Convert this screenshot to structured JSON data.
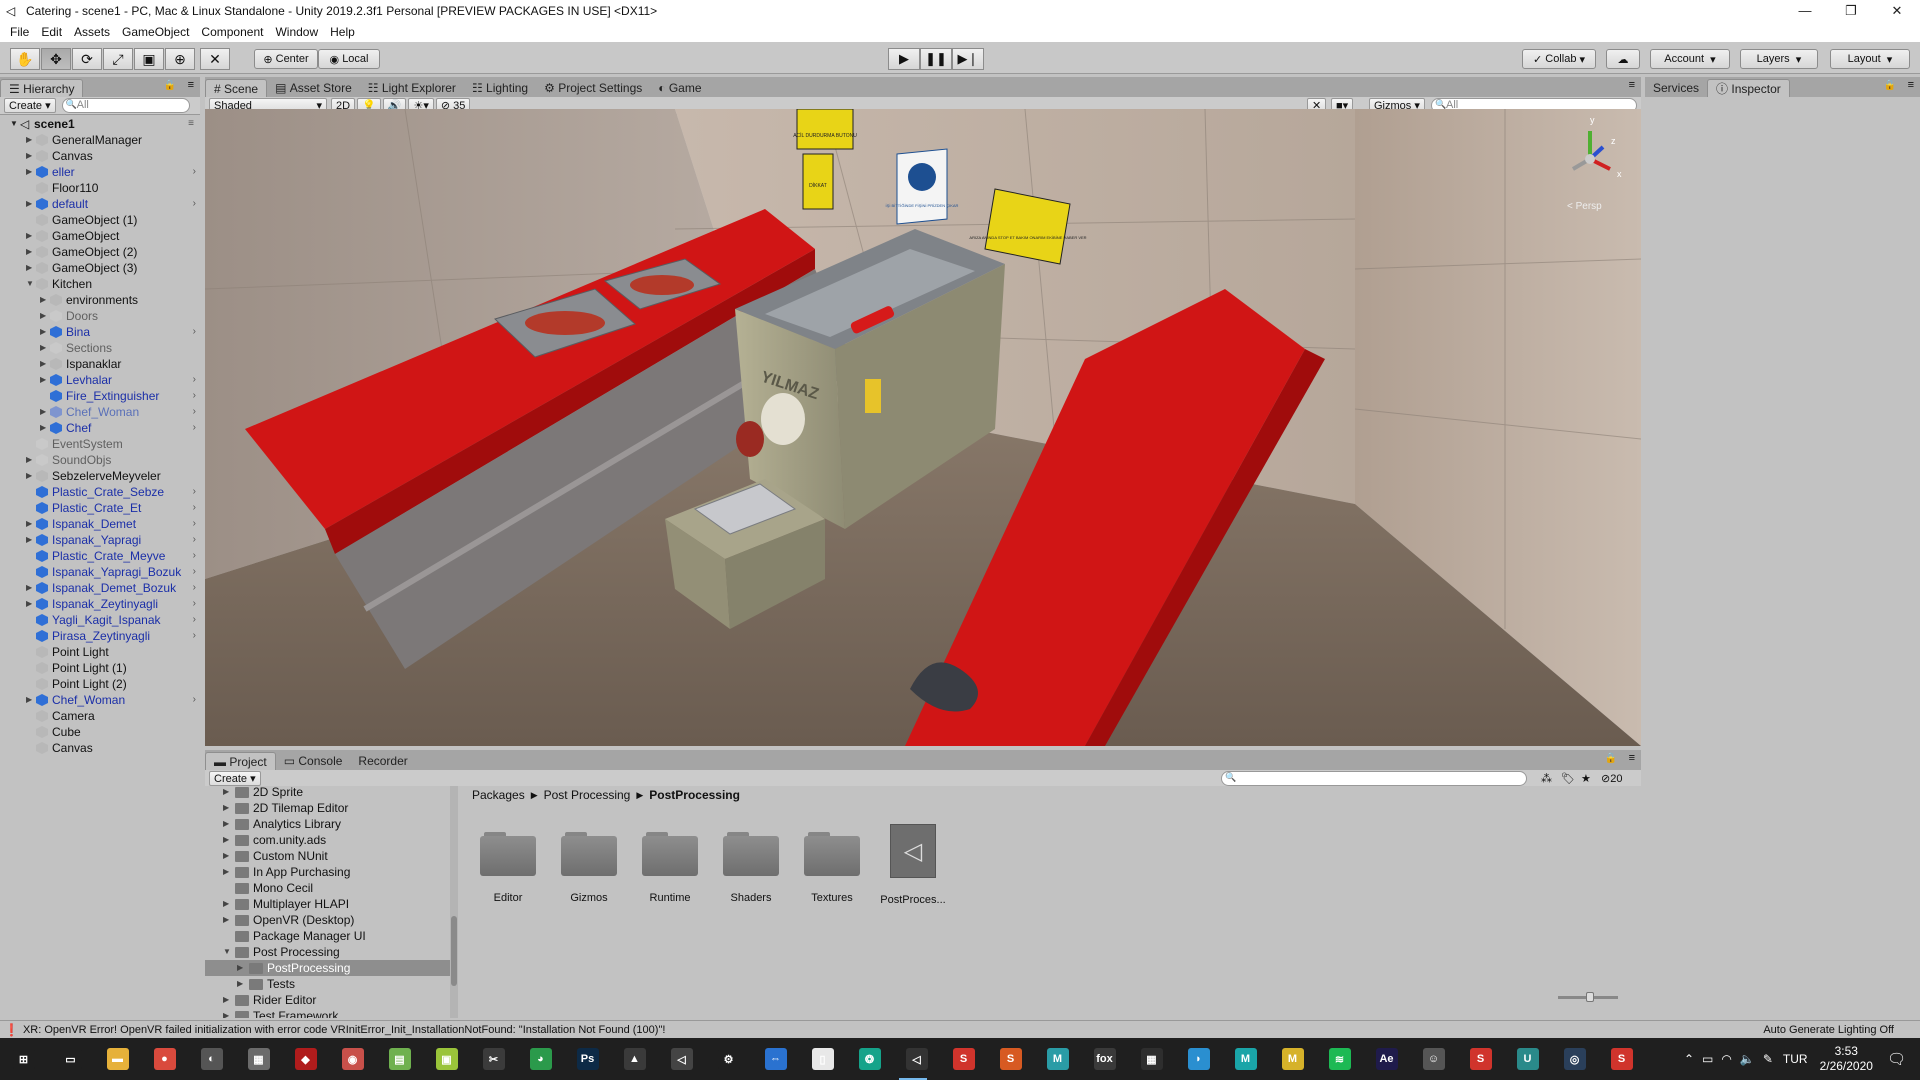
{
  "window": {
    "title": "Catering - scene1 - PC, Mac & Linux Standalone - Unity 2019.2.3f1 Personal [PREVIEW PACKAGES IN USE] <DX11>",
    "controls": [
      "—",
      "❐",
      "✕"
    ]
  },
  "menu": [
    "File",
    "Edit",
    "Assets",
    "GameObject",
    "Component",
    "Window",
    "Help"
  ],
  "toolbar": {
    "pivot": "Center",
    "space": "Local",
    "collab": "Collab",
    "account": "Account",
    "layers": "Layers",
    "layout": "Layout"
  },
  "hierarchy": {
    "tab": "Hierarchy",
    "create": "Create",
    "search_placeholder": "All",
    "scene": "scene1",
    "items": [
      {
        "label": "GeneralManager",
        "depth": 1,
        "type": "normal",
        "arrow": true
      },
      {
        "label": "Canvas",
        "depth": 1,
        "type": "normal",
        "arrow": true
      },
      {
        "label": "eller",
        "depth": 1,
        "type": "prefab",
        "arrow": true,
        "more": true
      },
      {
        "label": "Floor110",
        "depth": 1,
        "type": "normal",
        "arrow": false
      },
      {
        "label": "default",
        "depth": 1,
        "type": "prefab",
        "arrow": true,
        "more": true
      },
      {
        "label": "GameObject (1)",
        "depth": 1,
        "type": "normal",
        "arrow": false
      },
      {
        "label": "GameObject",
        "depth": 1,
        "type": "normal",
        "arrow": true
      },
      {
        "label": "GameObject (2)",
        "depth": 1,
        "type": "normal",
        "arrow": true
      },
      {
        "label": "GameObject (3)",
        "depth": 1,
        "type": "normal",
        "arrow": true
      },
      {
        "label": "Kitchen",
        "depth": 1,
        "type": "normal",
        "arrow": true,
        "open": true
      },
      {
        "label": "environments",
        "depth": 2,
        "type": "normal",
        "arrow": true
      },
      {
        "label": "Doors",
        "depth": 2,
        "type": "inactive",
        "arrow": true
      },
      {
        "label": "Bina",
        "depth": 2,
        "type": "prefab",
        "arrow": true,
        "more": true
      },
      {
        "label": "Sections",
        "depth": 2,
        "type": "inactive",
        "arrow": true
      },
      {
        "label": "Ispanaklar",
        "depth": 2,
        "type": "normal",
        "arrow": true
      },
      {
        "label": "Levhalar",
        "depth": 2,
        "type": "prefab",
        "arrow": true,
        "more": true
      },
      {
        "label": "Fire_Extinguisher",
        "depth": 2,
        "type": "prefab",
        "arrow": false,
        "more": true
      },
      {
        "label": "Chef_Woman",
        "depth": 2,
        "type": "prefab-inactive",
        "arrow": true,
        "more": true
      },
      {
        "label": "Chef",
        "depth": 2,
        "type": "prefab",
        "arrow": true,
        "more": true
      },
      {
        "label": "EventSystem",
        "depth": 1,
        "type": "inactive",
        "arrow": false
      },
      {
        "label": "SoundObjs",
        "depth": 1,
        "type": "inactive",
        "arrow": true
      },
      {
        "label": "SebzelerveMeyveler",
        "depth": 1,
        "type": "normal",
        "arrow": true
      },
      {
        "label": "Plastic_Crate_Sebze",
        "depth": 1,
        "type": "prefab",
        "arrow": false,
        "more": true
      },
      {
        "label": "Plastic_Crate_Et",
        "depth": 1,
        "type": "prefab",
        "arrow": false,
        "more": true
      },
      {
        "label": "Ispanak_Demet",
        "depth": 1,
        "type": "prefab",
        "arrow": true,
        "more": true
      },
      {
        "label": "Ispanak_Yapragi",
        "depth": 1,
        "type": "prefab",
        "arrow": true,
        "more": true
      },
      {
        "label": "Plastic_Crate_Meyve",
        "depth": 1,
        "type": "prefab",
        "arrow": false,
        "more": true
      },
      {
        "label": "Ispanak_Yapragi_Bozuk",
        "depth": 1,
        "type": "prefab",
        "arrow": false,
        "more": true
      },
      {
        "label": "Ispanak_Demet_Bozuk",
        "depth": 1,
        "type": "prefab",
        "arrow": true,
        "more": true
      },
      {
        "label": "Ispanak_Zeytinyagli",
        "depth": 1,
        "type": "prefab",
        "arrow": true,
        "more": true
      },
      {
        "label": "Yagli_Kagit_Ispanak",
        "depth": 1,
        "type": "prefab",
        "arrow": false,
        "more": true
      },
      {
        "label": "Pirasa_Zeytinyagli",
        "depth": 1,
        "type": "prefab",
        "arrow": false,
        "more": true
      },
      {
        "label": "Point Light",
        "depth": 1,
        "type": "normal",
        "arrow": false
      },
      {
        "label": "Point Light (1)",
        "depth": 1,
        "type": "normal",
        "arrow": false
      },
      {
        "label": "Point Light (2)",
        "depth": 1,
        "type": "normal",
        "arrow": false
      },
      {
        "label": "Chef_Woman",
        "depth": 1,
        "type": "prefab",
        "arrow": true,
        "more": true
      },
      {
        "label": "Camera",
        "depth": 1,
        "type": "normal",
        "arrow": false
      },
      {
        "label": "Cube",
        "depth": 1,
        "type": "normal",
        "arrow": false
      },
      {
        "label": "Canvas",
        "depth": 1,
        "type": "normal",
        "arrow": false
      }
    ]
  },
  "scene_tabs": [
    "Scene",
    "Asset Store",
    "Light Explorer",
    "Lighting",
    "Project Settings",
    "Game"
  ],
  "scene_bar": {
    "shading": "Shaded",
    "mode2d": "2D",
    "hidden_count": "35",
    "gizmos": "Gizmos",
    "search_placeholder": "All"
  },
  "scene_view": {
    "persp_label": "< Persp",
    "axis_y": "y",
    "axis_z": "z",
    "axis_x": "x",
    "machine_brand": "YILMAZ",
    "sign_right": "ARIZA ANINDA STOP ET BAKIM ONARIM EKİBİNE HABER VER",
    "sign_blue": "İŞİ BİTTİĞİNDE FİŞİNİ PRİZDEN ÇIKAR",
    "sign_left_top": "ACİL DURDURMA BUTONU",
    "sign_left_bottom": "DİKKAT"
  },
  "right_tabs": [
    "Services",
    "Inspector"
  ],
  "project": {
    "tabs": [
      "Project",
      "Console",
      "Recorder"
    ],
    "create": "Create",
    "hidden_count": "20",
    "breadcrumb": [
      "Packages",
      "Post Processing",
      "PostProcessing"
    ],
    "tree": [
      {
        "label": "2D Sprite",
        "depth": 1,
        "arrow": true
      },
      {
        "label": "2D Tilemap Editor",
        "depth": 1,
        "arrow": true
      },
      {
        "label": "Analytics Library",
        "depth": 1,
        "arrow": true
      },
      {
        "label": "com.unity.ads",
        "depth": 1,
        "arrow": true
      },
      {
        "label": "Custom NUnit",
        "depth": 1,
        "arrow": true
      },
      {
        "label": "In App Purchasing",
        "depth": 1,
        "arrow": true
      },
      {
        "label": "Mono Cecil",
        "depth": 1,
        "arrow": false
      },
      {
        "label": "Multiplayer HLAPI",
        "depth": 1,
        "arrow": true
      },
      {
        "label": "OpenVR (Desktop)",
        "depth": 1,
        "arrow": true
      },
      {
        "label": "Package Manager UI",
        "depth": 1,
        "arrow": false
      },
      {
        "label": "Post Processing",
        "depth": 1,
        "arrow": true,
        "open": true
      },
      {
        "label": "PostProcessing",
        "depth": 2,
        "arrow": true,
        "selected": true
      },
      {
        "label": "Tests",
        "depth": 2,
        "arrow": true
      },
      {
        "label": "Rider Editor",
        "depth": 1,
        "arrow": true
      },
      {
        "label": "Test Framework",
        "depth": 1,
        "arrow": true
      }
    ],
    "assets": [
      {
        "label": "Editor",
        "kind": "folder"
      },
      {
        "label": "Gizmos",
        "kind": "folder"
      },
      {
        "label": "Runtime",
        "kind": "folder"
      },
      {
        "label": "Shaders",
        "kind": "folder"
      },
      {
        "label": "Textures",
        "kind": "folder"
      },
      {
        "label": "PostProces...",
        "kind": "unity"
      }
    ]
  },
  "status": {
    "error": "XR: OpenVR Error! OpenVR failed initialization with error code VRInitError_Init_InstallationNotFound: \"Installation Not Found (100)\"!",
    "lighting": "Auto Generate Lighting Off"
  },
  "taskbar": {
    "lang": "TUR",
    "time": "3:53",
    "date": "2/26/2020",
    "apps": [
      {
        "name": "windows-start",
        "color": "#1f1f1f",
        "glyph": "⊞"
      },
      {
        "name": "task-view",
        "color": "#1f1f1f",
        "glyph": "▭"
      },
      {
        "name": "file-explorer",
        "color": "#e6b13a",
        "glyph": "▬"
      },
      {
        "name": "chrome",
        "color": "#d94a3d",
        "glyph": "●"
      },
      {
        "name": "unity-hub",
        "color": "#555555",
        "glyph": "◐"
      },
      {
        "name": "app-gray",
        "color": "#6b6b6b",
        "glyph": "▦"
      },
      {
        "name": "app-red",
        "color": "#b01c1c",
        "glyph": "◆"
      },
      {
        "name": "app-parrot",
        "color": "#c8504a",
        "glyph": "◉"
      },
      {
        "name": "notepad-plus",
        "color": "#6fb14f",
        "glyph": "▤"
      },
      {
        "name": "winrar",
        "color": "#9ac43a",
        "glyph": "▣"
      },
      {
        "name": "app-bench",
        "color": "#3b3b3b",
        "glyph": "✂"
      },
      {
        "name": "app-green",
        "color": "#2b9a4b",
        "glyph": "◕"
      },
      {
        "name": "photoshop",
        "color": "#0d2a46",
        "glyph": "Ps"
      },
      {
        "name": "nvidia",
        "color": "#3a3a3a",
        "glyph": "▲"
      },
      {
        "name": "visual-studio",
        "color": "#444444",
        "glyph": "◁"
      },
      {
        "name": "settings",
        "color": "#1f1f1f",
        "glyph": "⚙"
      },
      {
        "name": "teamviewer",
        "color": "#2a72d0",
        "glyph": "⇔"
      },
      {
        "name": "document",
        "color": "#e8e8e8",
        "glyph": "▯"
      },
      {
        "name": "gitkraken",
        "color": "#15a38a",
        "glyph": "❂"
      },
      {
        "name": "unity",
        "color": "#333333",
        "glyph": "◁"
      },
      {
        "name": "app-s-red",
        "color": "#d0342c",
        "glyph": "S"
      },
      {
        "name": "app-s-orange",
        "color": "#d75a22",
        "glyph": "S"
      },
      {
        "name": "maya",
        "color": "#2a9ca6",
        "glyph": "M"
      },
      {
        "name": "app-fox",
        "color": "#3a3a3a",
        "glyph": "fox"
      },
      {
        "name": "calculator",
        "color": "#2e2e2e",
        "glyph": "▦"
      },
      {
        "name": "app-bird",
        "color": "#2a8fd0",
        "glyph": "◗"
      },
      {
        "name": "maya-2",
        "color": "#1aa5a8",
        "glyph": "M"
      },
      {
        "name": "app-m-yellow",
        "color": "#d6b22a",
        "glyph": "M"
      },
      {
        "name": "spotify",
        "color": "#1db954",
        "glyph": "≋"
      },
      {
        "name": "after-effects",
        "color": "#1f1b4b",
        "glyph": "Ae"
      },
      {
        "name": "app-robot",
        "color": "#555555",
        "glyph": "☺"
      },
      {
        "name": "app-s-red-2",
        "color": "#d0342c",
        "glyph": "S"
      },
      {
        "name": "app-u",
        "color": "#2a8a8a",
        "glyph": "U"
      },
      {
        "name": "steam",
        "color": "#2a3f5a",
        "glyph": "◎"
      },
      {
        "name": "app-s-red-3",
        "color": "#d0342c",
        "glyph": "S"
      }
    ]
  }
}
